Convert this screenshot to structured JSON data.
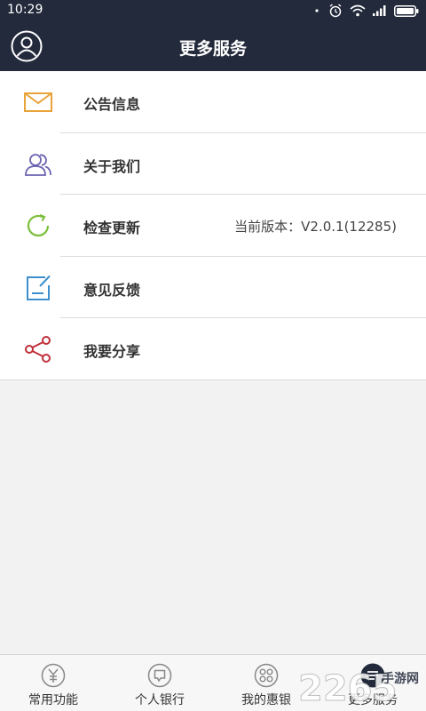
{
  "status_bar": {
    "time": "10:29",
    "icons": [
      "more-dots-icon",
      "alarm-icon",
      "wifi-icon",
      "signal-icon",
      "battery-icon"
    ]
  },
  "header": {
    "title": "更多服务",
    "left_icon": "user-avatar-icon",
    "background": "#232a3c"
  },
  "menu": {
    "items": [
      {
        "label": "公告信息",
        "icon": "envelope-icon",
        "color": "#e8a33a"
      },
      {
        "label": "关于我们",
        "icon": "users-icon",
        "color": "#6b64b0"
      },
      {
        "label": "检查更新",
        "icon": "refresh-icon",
        "color": "#7cbf3b",
        "value": "当前版本：V2.0.1(12285)"
      },
      {
        "label": "意见反馈",
        "icon": "edit-note-icon",
        "color": "#3c8fcc"
      },
      {
        "label": "我要分享",
        "icon": "share-icon",
        "color": "#c0303a"
      }
    ]
  },
  "tabbar": {
    "tabs": [
      {
        "label": "常用功能",
        "icon": "yen-circle-icon",
        "active": false
      },
      {
        "label": "个人银行",
        "icon": "message-circle-icon",
        "active": false
      },
      {
        "label": "我的惠银",
        "icon": "grid-circle-icon",
        "active": false
      },
      {
        "label": "更多服务",
        "icon": "menu-circle-icon",
        "active": true
      }
    ],
    "active_color": "#232a3c"
  },
  "watermark": {
    "number": "2265",
    "text": "手游网"
  }
}
